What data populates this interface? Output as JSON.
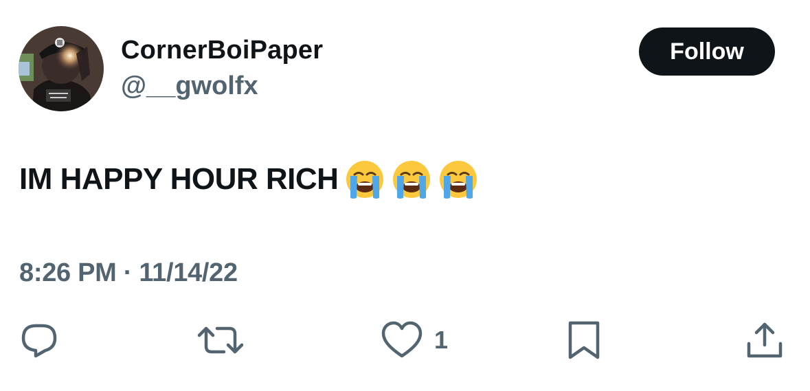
{
  "author": {
    "display_name": "CornerBoiPaper",
    "handle": "@__gwolfx",
    "avatar_icon": "profile-photo"
  },
  "follow_label": "Follow",
  "tweet": {
    "text": "IM HAPPY HOUR RICH",
    "emoji": [
      "loudly-crying-face",
      "loudly-crying-face",
      "loudly-crying-face"
    ],
    "timestamp": "8:26 PM · 11/14/22"
  },
  "actions": {
    "reply": {
      "icon": "reply-icon"
    },
    "retweet": {
      "icon": "retweet-icon"
    },
    "like": {
      "icon": "heart-icon",
      "count": "1"
    },
    "bookmark": {
      "icon": "bookmark-icon"
    },
    "share": {
      "icon": "share-icon"
    }
  },
  "colors": {
    "text_primary": "#0f1419",
    "text_secondary": "#536471",
    "button_bg": "#0f1419",
    "button_text": "#ffffff",
    "background": "#ffffff"
  }
}
